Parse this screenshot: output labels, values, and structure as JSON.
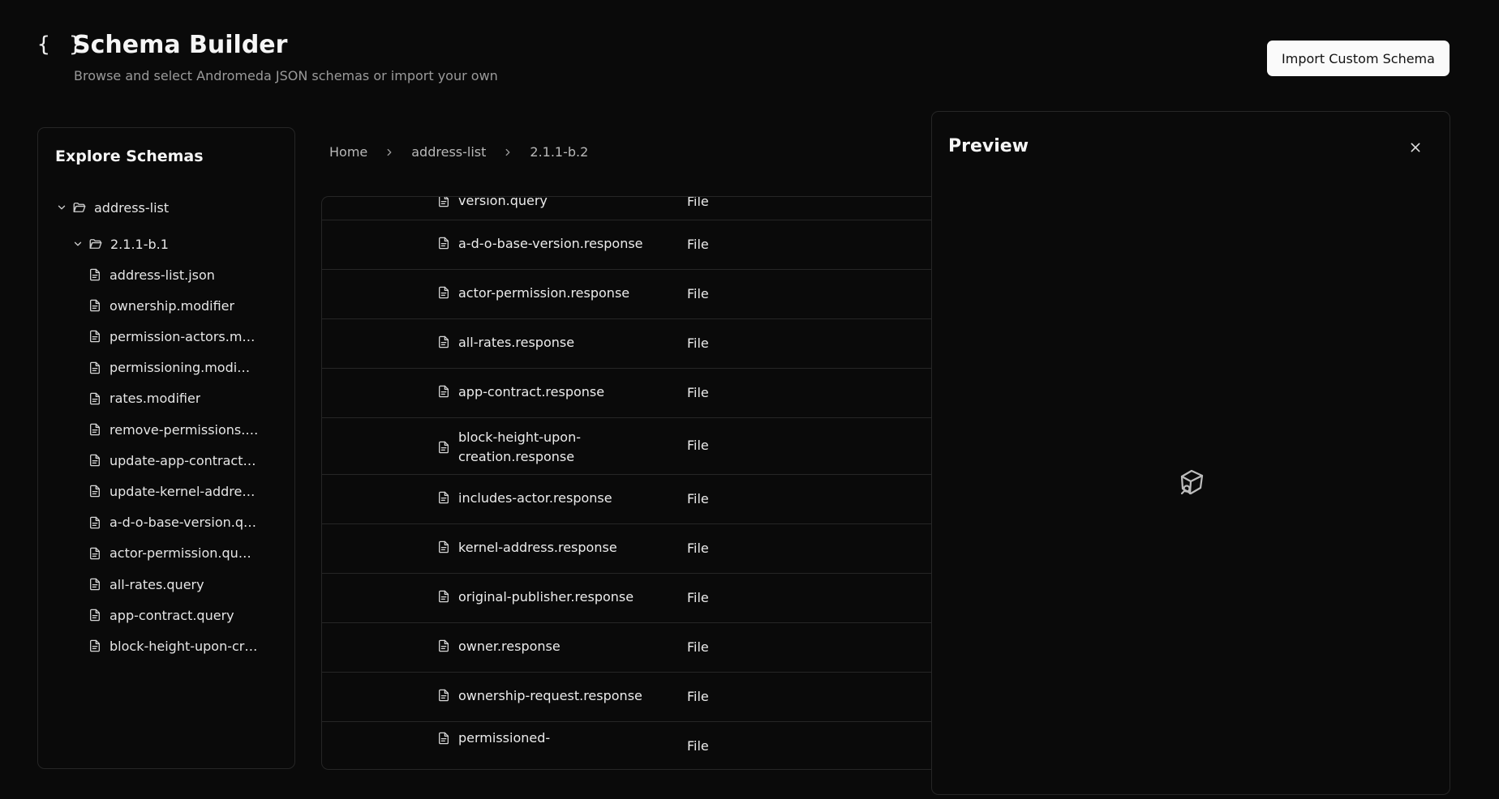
{
  "header": {
    "icon": "{ }",
    "title": "Schema Builder",
    "subtitle": "Browse and select Andromeda JSON schemas or import your own",
    "import_button": "Import Custom Schema"
  },
  "sidebar": {
    "title": "Explore Schemas",
    "root": "address-list",
    "version": "2.1.1-b.1",
    "files": [
      "address-list.json",
      "ownership.modifier",
      "permission-actors.m…",
      "permissioning.modi…",
      "rates.modifier",
      "remove-permissions.…",
      "update-app-contract…",
      "update-kernel-addre…",
      "a-d-o-base-version.q…",
      "actor-permission.qu…",
      "all-rates.query",
      "app-contract.query",
      "block-height-upon-cr…"
    ]
  },
  "breadcrumb": [
    "Home",
    "address-list",
    "2.1.1-b.2"
  ],
  "table": {
    "rows": [
      {
        "name": "version.query",
        "type": "File"
      },
      {
        "name": "a-d-o-base-version.response",
        "type": "File"
      },
      {
        "name": "actor-permission.response",
        "type": "File"
      },
      {
        "name": "all-rates.response",
        "type": "File"
      },
      {
        "name": "app-contract.response",
        "type": "File"
      },
      {
        "name": "block-height-upon-creation.response",
        "type": "File"
      },
      {
        "name": "includes-actor.response",
        "type": "File"
      },
      {
        "name": "kernel-address.response",
        "type": "File"
      },
      {
        "name": "original-publisher.response",
        "type": "File"
      },
      {
        "name": "owner.response",
        "type": "File"
      },
      {
        "name": "ownership-request.response",
        "type": "File"
      },
      {
        "name": "permissioned-",
        "type": "File"
      }
    ]
  },
  "preview": {
    "title": "Preview",
    "close_icon": "close-icon",
    "placeholder_icon": "cube-icon"
  }
}
